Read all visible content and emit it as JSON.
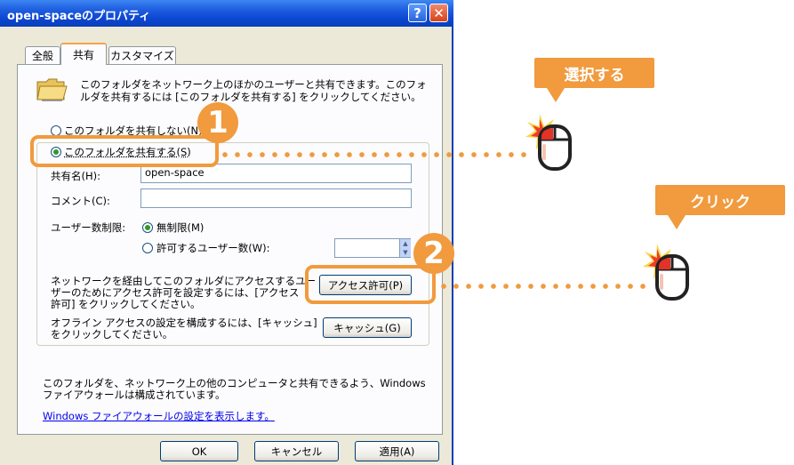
{
  "window": {
    "title": "open-spaceのプロパティ",
    "help_glyph": "?",
    "close_glyph": "✕"
  },
  "tabs": [
    {
      "label": "全般"
    },
    {
      "label": "共有",
      "active": true
    },
    {
      "label": "カスタマイズ"
    }
  ],
  "intro": {
    "line1": "このフォルダをネットワーク上のほかのユーザーと共有できます。このフォ",
    "line2": "ルダを共有するには [このフォルダを共有する] をクリックしてください。",
    "icon": "folder-icon"
  },
  "share_options": {
    "no_share_label": "このフォルダを共有しない(N)",
    "share_label": "このフォルダを共有する(S)",
    "selected": "share"
  },
  "fields": {
    "share_name_label": "共有名(H):",
    "share_name_value": "open-space",
    "comment_label": "コメント(C):",
    "comment_value": ""
  },
  "user_limit": {
    "label": "ユーザー数制限:",
    "unlimited_label": "無制限(M)",
    "allow_label": "許可するユーザー数(W):",
    "selected": "unlimited",
    "spinner_value": ""
  },
  "permissions": {
    "desc1": "ネットワークを経由してこのフォルダにアクセスするユー",
    "desc2": "ザーのためにアクセス許可を設定するには、[アクセス",
    "desc3": "許可] をクリックしてください。",
    "button_label": "アクセス許可(P)"
  },
  "caching": {
    "desc1": "オフライン アクセスの設定を構成するには、[キャッシュ]",
    "desc2": "をクリックしてください。",
    "button_label": "キャッシュ(G)"
  },
  "firewall": {
    "line1": "このフォルダを、ネットワーク上の他のコンピュータと共有できるよう、Windows",
    "line2": "ファイアウォールは構成されています。",
    "link": "Windows ファイアウォールの設定を表示します。"
  },
  "footer": {
    "ok_label": "OK",
    "cancel_label": "キャンセル",
    "apply_label": "適用(A)"
  },
  "annotations": {
    "step1_number": "1",
    "step2_number": "2",
    "select_label": "選択する",
    "click_label": "クリック",
    "accent": "#f19a3e"
  },
  "colors": {
    "titlebar": "#0a3fb8",
    "dialog_bg": "#ece9d8",
    "accent": "#f19a3e"
  }
}
